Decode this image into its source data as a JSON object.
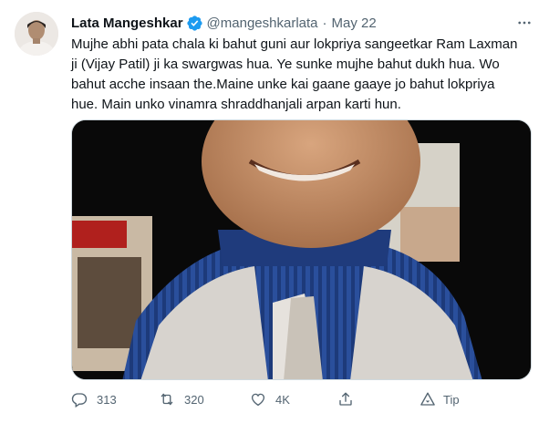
{
  "tweet": {
    "author_name": "Lata Mangeshkar",
    "handle": "@mangeshkarlata",
    "separator": "·",
    "date": "May 22",
    "text_lines": [
      "Mujhe abhi pata chala ki bahut guni aur lokpriya sangeetkar Ram Laxman",
      "ji (Vijay Patil) ji ka swargwas hua. Ye sunke mujhe bahut dukh hua. Wo",
      "bahut acche insaan the.Maine unke kai gaane gaaye jo bahut lokpriya",
      "hue. Main unko vinamra shraddhanjali arpan karti hun."
    ]
  },
  "actions": {
    "reply_count": "313",
    "retweet_count": "320",
    "like_count": "4K",
    "tip_label": "Tip"
  },
  "colors": {
    "text_primary": "#0f1419",
    "text_secondary": "#536471",
    "verified": "#1d9bf0"
  },
  "icons": {
    "more": "more-icon",
    "verified": "verified-badge-icon",
    "reply": "reply-icon",
    "retweet": "retweet-icon",
    "like": "like-icon",
    "share": "share-icon",
    "tip": "tip-icon"
  }
}
